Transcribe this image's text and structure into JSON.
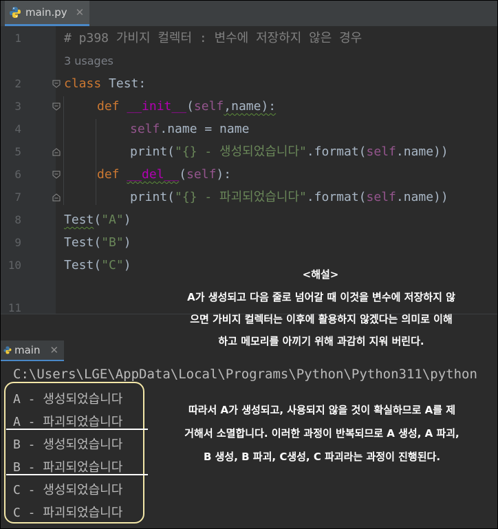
{
  "editor": {
    "tab": {
      "filename": "main.py",
      "close": "✕"
    },
    "line_numbers": [
      "1",
      "2",
      "3",
      "4",
      "5",
      "6",
      "7",
      "8",
      "9",
      "10",
      "11"
    ],
    "usages": "3 usages",
    "code": {
      "l1": "# p398 가비지 컬렉터 : 변수에 저장하지 않은 경우",
      "l2_kw": "class",
      "l2_rest": " Test:",
      "l3_kw": "def",
      "l3_fn": "__init__",
      "l3_open": "(",
      "l3_self": "self",
      "l3_rest": ",name):",
      "l4_self": "self",
      "l4_rest": ".name = name",
      "l5_print": "print(",
      "l5_str": "\"{} - 생성되었습니다\"",
      "l5_mid": ".format(",
      "l5_self": "self",
      "l5_end": ".name))",
      "l6_kw": "def",
      "l6_fn": "__del__",
      "l6_open": "(",
      "l6_self": "self",
      "l6_end": "):",
      "l7_print": "print(",
      "l7_str": "\"{} - 파괴되었습니다\"",
      "l7_mid": ".format(",
      "l7_self": "self",
      "l7_end": ".name))",
      "l8_name": "Test",
      "l8_open": "(",
      "l8_str": "\"A\"",
      "l8_end": ")",
      "l9_name": "Test",
      "l9_open": "(",
      "l9_str": "\"B\"",
      "l9_end": ")",
      "l10_name": "Test",
      "l10_open": "(",
      "l10_str": "\"C\"",
      "l10_end": ")"
    }
  },
  "explanation": {
    "title": "<해설>",
    "line1": "A가 생성되고 다음 줄로 넘어갈 때 이것을 변수에 저장하지 않",
    "line2": "으면 가비지 컬렉터는 이후에 활용하지 않겠다는 의미로 이해",
    "line3": "하고 메모리를 아끼기 위해 과감히 지워 버린다."
  },
  "run": {
    "tab_label": "main",
    "close": "✕",
    "command": "C:\\Users\\LGE\\AppData\\Local\\Programs\\Python\\Python311\\python",
    "output": [
      "A - 생성되었습니다",
      "A - 파괴되었습니다",
      "B - 생성되었습니다",
      "B - 파괴되었습니다",
      "C - 생성되었습니다",
      "C - 파괴되었습니다"
    ]
  },
  "explanation2": {
    "line1": "따라서 A가 생성되고, 사용되지 않을 것이 확실하므로 A를 제",
    "line2": "거해서 소멸합니다. 이러한 과정이 반복되므로 A 생성, A 파괴,",
    "line3": "B 생성, B 파괴, C생성, C 파괴라는 과정이 진행된다."
  },
  "colors": {
    "keyword": "#cc7832",
    "dunder": "#b200b2",
    "self": "#94558d",
    "string": "#6a8759",
    "comment": "#808080",
    "output_box": "#f3e7a8"
  }
}
